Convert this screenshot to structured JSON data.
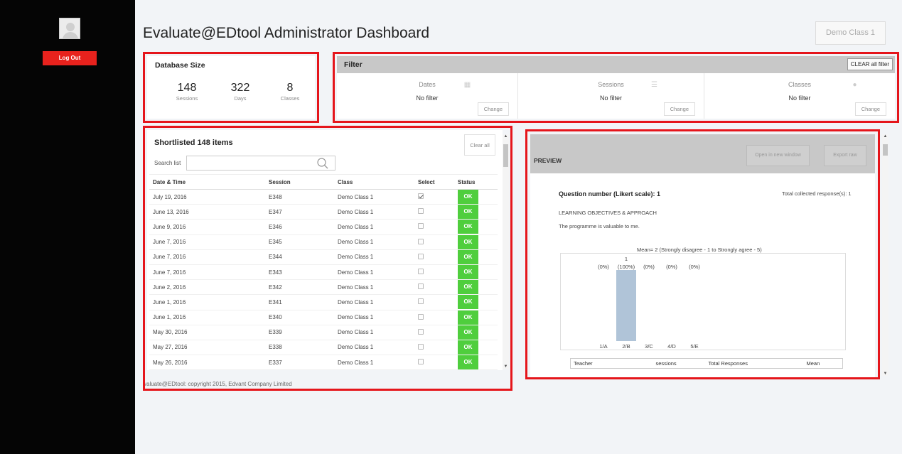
{
  "app": {
    "title": "Evaluate@EDtool Administrator Dashboard",
    "logout_label": "Log Out",
    "class_selector": "Demo Class 1",
    "copyright": "valuate@EDtool: copyright 2015, Edvant Company Limited"
  },
  "database": {
    "title": "Database Size",
    "stats": [
      {
        "value": "148",
        "label": "Sessions"
      },
      {
        "value": "322",
        "label": "Days"
      },
      {
        "value": "8",
        "label": "Classes"
      }
    ]
  },
  "filter": {
    "title": "Filter",
    "clear_label": "CLEAR all filter",
    "columns": [
      {
        "title": "Dates",
        "value": "No filter",
        "change": "Change",
        "icon": "calendar-icon"
      },
      {
        "title": "Sessions",
        "value": "No filter",
        "change": "Change",
        "icon": "list-icon"
      },
      {
        "title": "Classes",
        "value": "No filter",
        "change": "Change",
        "icon": "user-icon"
      }
    ]
  },
  "shortlist": {
    "title": "Shortlisted 148 items",
    "clear_label": "Clear all",
    "search_label": "Search list",
    "search_placeholder": "",
    "headers": {
      "date": "Date & Time",
      "session": "Session",
      "class": "Class",
      "select": "Select",
      "status": "Status"
    },
    "rows": [
      {
        "date": "July 19, 2016",
        "session": "E348",
        "class": "Demo Class 1",
        "selected": true,
        "status": "OK"
      },
      {
        "date": "June 13, 2016",
        "session": "E347",
        "class": "Demo Class 1",
        "selected": false,
        "status": "OK"
      },
      {
        "date": "June 9, 2016",
        "session": "E346",
        "class": "Demo Class 1",
        "selected": false,
        "status": "OK"
      },
      {
        "date": "June 7, 2016",
        "session": "E345",
        "class": "Demo Class 1",
        "selected": false,
        "status": "OK"
      },
      {
        "date": "June 7, 2016",
        "session": "E344",
        "class": "Demo Class 1",
        "selected": false,
        "status": "OK"
      },
      {
        "date": "June 7, 2016",
        "session": "E343",
        "class": "Demo Class 1",
        "selected": false,
        "status": "OK"
      },
      {
        "date": "June 2, 2016",
        "session": "E342",
        "class": "Demo Class 1",
        "selected": false,
        "status": "OK"
      },
      {
        "date": "June 1, 2016",
        "session": "E341",
        "class": "Demo Class 1",
        "selected": false,
        "status": "OK"
      },
      {
        "date": "June 1, 2016",
        "session": "E340",
        "class": "Demo Class 1",
        "selected": false,
        "status": "OK"
      },
      {
        "date": "May 30, 2016",
        "session": "E339",
        "class": "Demo Class 1",
        "selected": false,
        "status": "OK"
      },
      {
        "date": "May 27, 2016",
        "session": "E338",
        "class": "Demo Class 1",
        "selected": false,
        "status": "OK"
      },
      {
        "date": "May 26, 2016",
        "session": "E337",
        "class": "Demo Class 1",
        "selected": false,
        "status": "OK"
      }
    ]
  },
  "preview": {
    "title": "PREVIEW",
    "open_label": "Open in new window",
    "export_label": "Export raw",
    "question_title": "Question number (Likert scale): 1",
    "total_responses": "Total collected response(s): 1",
    "section": "LEARNING OBJECTIVES & APPROACH",
    "statement": "The programme is valuable to me.",
    "table_headers": {
      "teacher": "Teacher",
      "sessions": "sessions",
      "total": "Total Responses",
      "mean": "Mean"
    }
  },
  "chart_data": {
    "type": "bar",
    "title": "Mean= 2 (Strongly disagree - 1 to Strongly agree - 5)",
    "categories": [
      "1/A",
      "2/B",
      "3/C",
      "4/D",
      "5/E"
    ],
    "values": [
      0,
      1,
      0,
      0,
      0
    ],
    "value_labels": [
      "",
      "1",
      "",
      "",
      ""
    ],
    "percent_labels": [
      "(0%)",
      "(100%)",
      "(0%)",
      "(0%)",
      "(0%)"
    ],
    "ylim": [
      0,
      1
    ],
    "bar_color": "#b0c4d8"
  },
  "colors": {
    "sidebar": "#050505",
    "logout": "#e8221d",
    "highlight": "#e5151b",
    "ok": "#4fce3d"
  }
}
